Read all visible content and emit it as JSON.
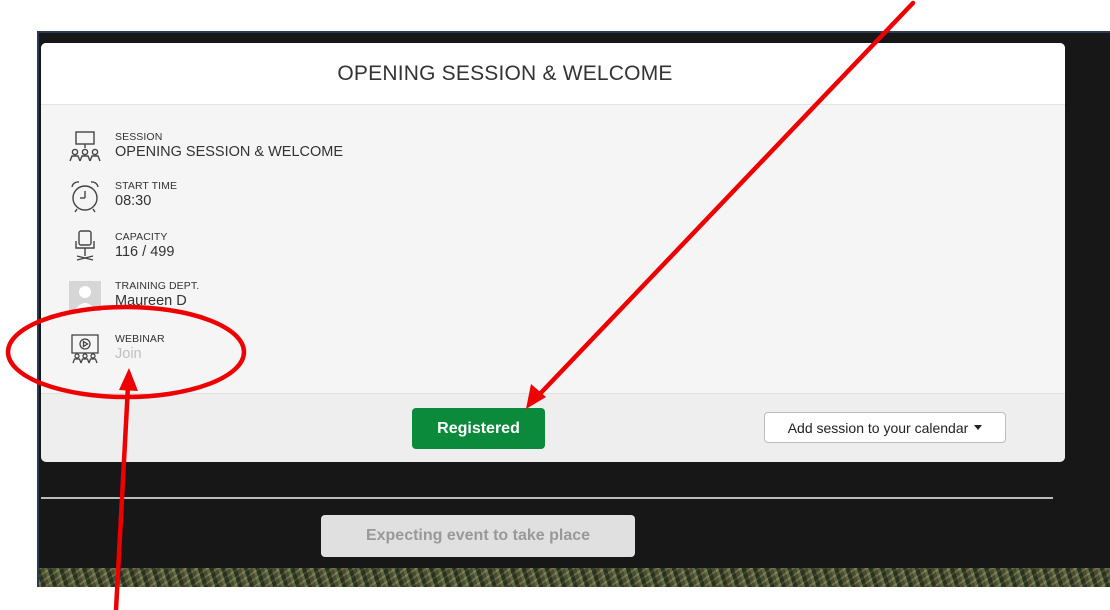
{
  "session": {
    "title": "OPENING SESSION & WELCOME",
    "details": [
      {
        "label": "SESSION",
        "value": "OPENING SESSION & WELCOME",
        "icon": "presentation-icon"
      },
      {
        "label": "START TIME",
        "value": "08:30",
        "icon": "alarm-clock-icon"
      },
      {
        "label": "CAPACITY",
        "value": "116 / 499",
        "icon": "office-chair-icon"
      },
      {
        "label": "TRAINING DEPT.",
        "value": "Maureen D",
        "icon": "avatar-placeholder-icon"
      },
      {
        "label": "WEBINAR",
        "value": "Join",
        "icon": "webinar-icon"
      }
    ]
  },
  "footer": {
    "registered_label": "Registered",
    "calendar_label": "Add session to your calendar"
  },
  "status": {
    "expecting_label": "Expecting event to take place"
  },
  "colors": {
    "registered": "#0c8a3c",
    "annotation": "#ee0000",
    "background": "#171717"
  }
}
